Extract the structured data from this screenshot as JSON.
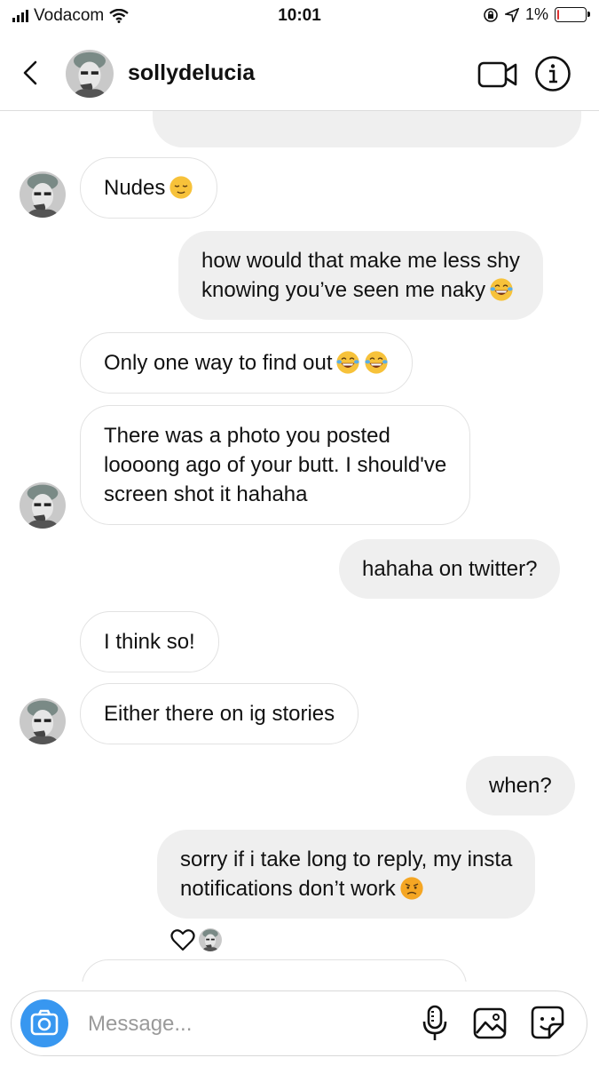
{
  "status_bar": {
    "carrier": "Vodacom",
    "time": "10:01",
    "battery": "1%",
    "battery_level": 0.01
  },
  "header": {
    "username": "sollydelucia"
  },
  "messages": {
    "m2": {
      "text": "Nudes"
    },
    "m3": {
      "line1": "how would that make me less shy",
      "line2": "knowing you’ve seen me naky"
    },
    "m4": {
      "text": "Only one way to find out"
    },
    "m5": {
      "line1": "There was a photo you posted",
      "line2": "loooong ago of your butt. I should've",
      "line3": "screen shot it hahaha"
    },
    "m6": {
      "text": "hahaha on twitter?"
    },
    "m7": {
      "text": "I think so!"
    },
    "m8": {
      "text": "Either there on ig stories"
    },
    "m9": {
      "text": "when?"
    },
    "m10": {
      "line1": "sorry if i take long to reply, my insta",
      "line2": "notifications don’t work"
    }
  },
  "composer": {
    "placeholder": "Message..."
  },
  "icons": {
    "back": "chevron-left-icon",
    "video": "video-call-icon",
    "info": "info-icon",
    "camera": "camera-icon",
    "mic": "microphone-icon",
    "gallery": "gallery-icon",
    "sticker": "sticker-icon",
    "reaction": "heart-icon"
  },
  "colors": {
    "accent": "#3897f0",
    "outgoing_bubble": "#efefef",
    "incoming_border": "#e2e2e2"
  }
}
